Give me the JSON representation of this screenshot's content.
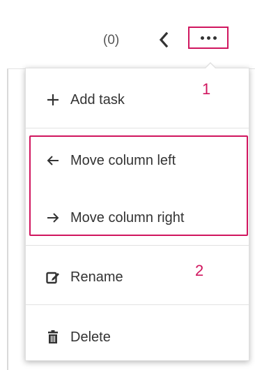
{
  "header": {
    "task_count": "(0)"
  },
  "menu": {
    "items": [
      {
        "label": "Add task",
        "icon": "plus-icon"
      },
      {
        "label": "Move column left",
        "icon": "arrow-left-icon"
      },
      {
        "label": "Move column right",
        "icon": "arrow-right-icon"
      },
      {
        "label": "Rename",
        "icon": "edit-icon"
      },
      {
        "label": "Delete",
        "icon": "trash-icon"
      }
    ]
  },
  "annotations": {
    "callout_1": "1",
    "callout_2": "2"
  },
  "colors": {
    "highlight": "#d0155e",
    "text": "#333333",
    "muted": "#555555",
    "divider": "#e2e2e2"
  }
}
